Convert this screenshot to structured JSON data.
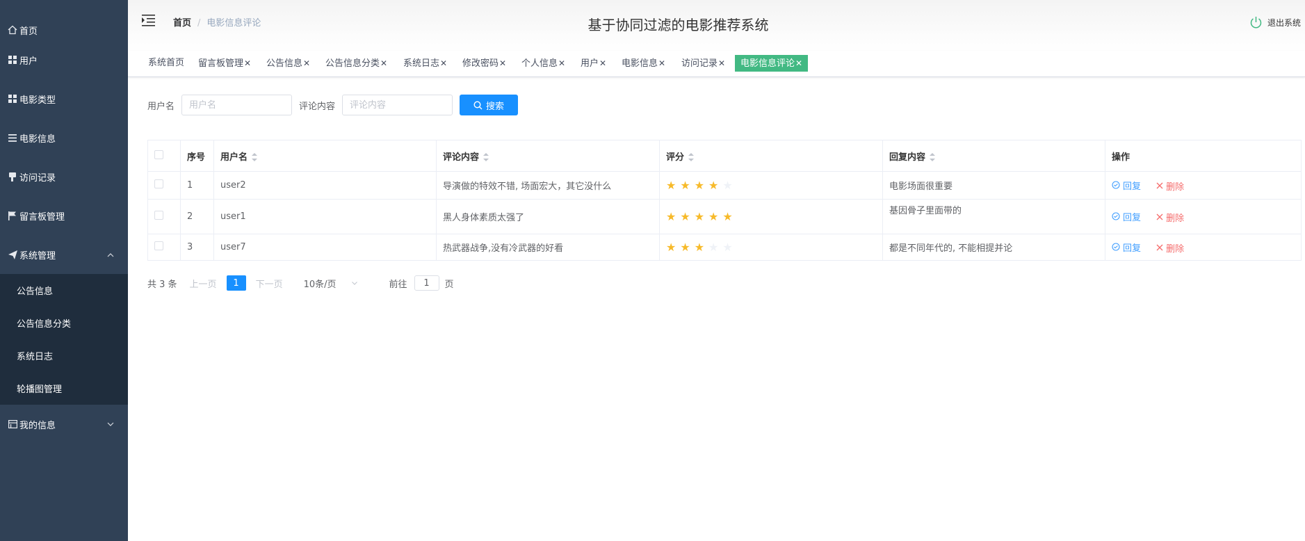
{
  "sidebar": {
    "items": [
      {
        "label": "首页",
        "icon": "home-icon"
      },
      {
        "label": "用户",
        "icon": "grid-icon"
      },
      {
        "label": "电影类型",
        "icon": "grid-icon"
      },
      {
        "label": "电影信息",
        "icon": "list-icon"
      },
      {
        "label": "访问记录",
        "icon": "thumb-icon"
      },
      {
        "label": "留言板管理",
        "icon": "flag-icon"
      },
      {
        "label": "系统管理",
        "icon": "send-icon"
      }
    ],
    "sub_items": [
      "公告信息",
      "公告信息分类",
      "系统日志",
      "轮播图管理"
    ],
    "my_info": "我的信息"
  },
  "header": {
    "breadcrumb_home": "首页",
    "breadcrumb_sep": "/",
    "breadcrumb_current": "电影信息评论",
    "title": "基于协同过滤的电影推荐系统",
    "logout": "退出系统"
  },
  "tags": [
    {
      "label": "系统首页",
      "closable": false
    },
    {
      "label": "留言板管理",
      "closable": true
    },
    {
      "label": "公告信息",
      "closable": true
    },
    {
      "label": "公告信息分类",
      "closable": true
    },
    {
      "label": "系统日志",
      "closable": true
    },
    {
      "label": "修改密码",
      "closable": true
    },
    {
      "label": "个人信息",
      "closable": true
    },
    {
      "label": "用户",
      "closable": true
    },
    {
      "label": "电影信息",
      "closable": true
    },
    {
      "label": "访问记录",
      "closable": true
    },
    {
      "label": "电影信息评论",
      "closable": true,
      "active": true
    }
  ],
  "search": {
    "username_label": "用户名",
    "username_placeholder": "用户名",
    "comment_label": "评论内容",
    "comment_placeholder": "评论内容",
    "button": "搜索"
  },
  "table": {
    "headers": [
      "序号",
      "用户名",
      "评论内容",
      "评分",
      "回复内容",
      "操作"
    ],
    "rows": [
      {
        "index": "1",
        "username": "user2",
        "comment": "导演做的特效不错, 场面宏大，其它没什么",
        "rating": 4,
        "reply": "电影场面很重要"
      },
      {
        "index": "2",
        "username": "user1",
        "comment": "黑人身体素质太强了",
        "rating": 5,
        "reply": "基因骨子里面带的"
      },
      {
        "index": "3",
        "username": "user7",
        "comment": "热武器战争,没有冷武器的好看",
        "rating": 3,
        "reply": "都是不同年代的, 不能相提并论"
      }
    ],
    "reply_label": "回复",
    "delete_label": "删除"
  },
  "pagination": {
    "total": "共 3 条",
    "prev": "上一页",
    "page": "1",
    "next": "下一页",
    "page_size": "10条/页",
    "goto_label": "前往",
    "goto_value": "1",
    "goto_suffix": "页"
  },
  "colors": {
    "sidebar_bg": "#304156",
    "submenu_bg": "#1f2d3d",
    "active_tag": "#42b983",
    "primary": "#1890ff",
    "danger": "#f56c6c",
    "star": "#f7ba2a"
  }
}
